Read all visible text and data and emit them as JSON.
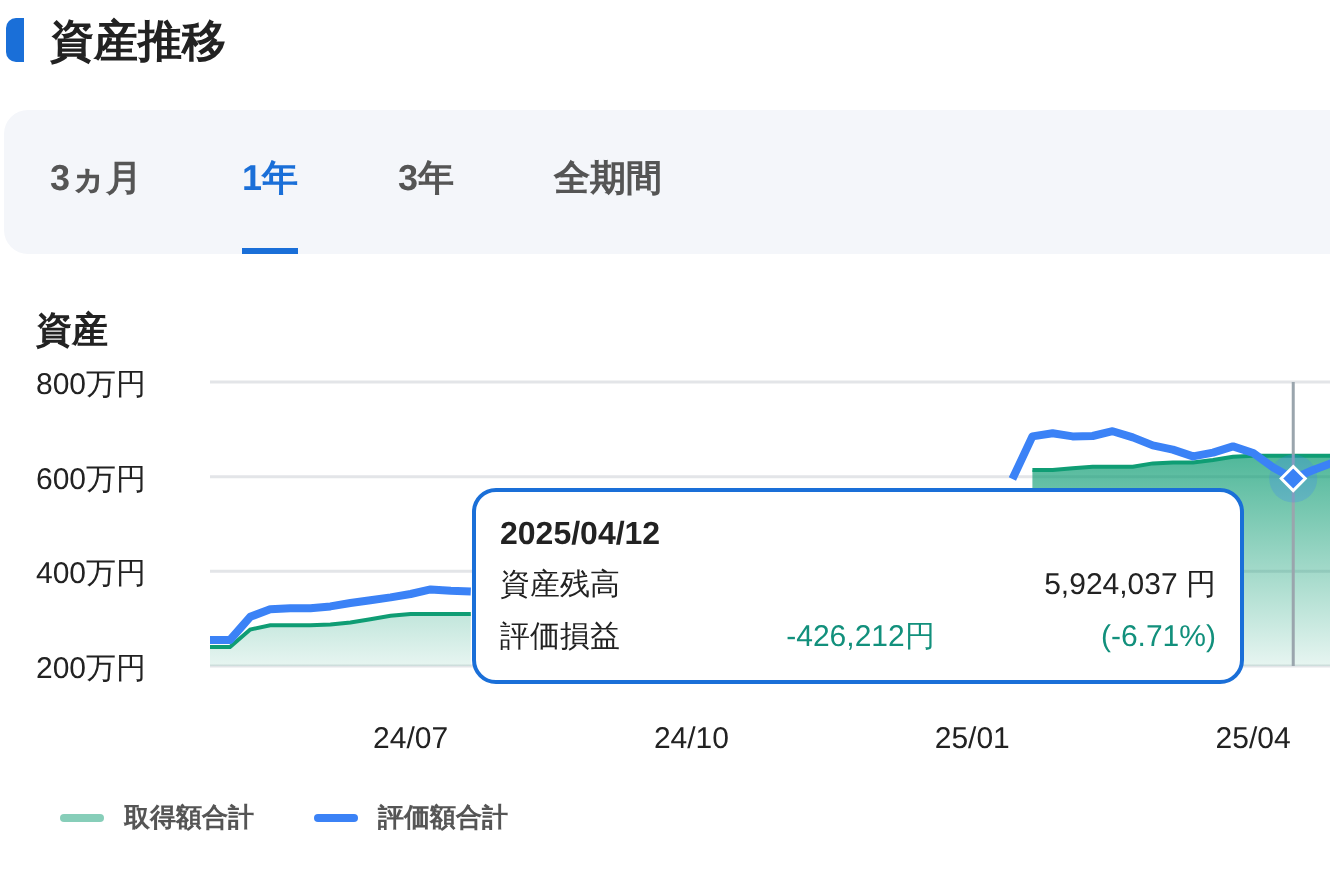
{
  "title": "資産推移",
  "tabs": [
    {
      "label": "3ヵ月",
      "selected": false
    },
    {
      "label": "1年",
      "selected": true
    },
    {
      "label": "3年",
      "selected": false
    },
    {
      "label": "全期間",
      "selected": false
    }
  ],
  "section_title": "資産",
  "chart_data": {
    "type": "line",
    "categories": [
      null,
      null,
      null,
      null,
      null,
      null,
      null,
      null,
      null,
      null,
      "24/07",
      null,
      null,
      null,
      null,
      null,
      null,
      null,
      null,
      null,
      null,
      null,
      null,
      null,
      "24/10",
      null,
      null,
      null,
      null,
      null,
      null,
      null,
      null,
      null,
      null,
      null,
      null,
      null,
      "25/01",
      null,
      null,
      null,
      null,
      null,
      null,
      null,
      null,
      null,
      null,
      null,
      null,
      null,
      "25/04",
      null,
      null,
      null,
      null
    ],
    "series": [
      {
        "name": "取得額合計",
        "color": "#0f9d74",
        "values": [
          240,
          240,
          277,
          286,
          286,
          286,
          288,
          292,
          299,
          306,
          310,
          310,
          310,
          310,
          null,
          null,
          null,
          null,
          null,
          null,
          null,
          null,
          null,
          null,
          null,
          null,
          null,
          null,
          null,
          null,
          null,
          null,
          null,
          null,
          null,
          null,
          null,
          null,
          null,
          null,
          null,
          614,
          614,
          618,
          621,
          621,
          621,
          628,
          630,
          630,
          635,
          642,
          644,
          644,
          644,
          644,
          644
        ]
      },
      {
        "name": "評価額合計",
        "color": "#3b82f6",
        "values": [
          255,
          255,
          304,
          320,
          322,
          322,
          326,
          333,
          339,
          345,
          352,
          362,
          359,
          357,
          null,
          null,
          null,
          null,
          null,
          null,
          null,
          null,
          null,
          null,
          null,
          null,
          null,
          null,
          null,
          null,
          null,
          null,
          null,
          null,
          null,
          null,
          null,
          null,
          null,
          null,
          595,
          685,
          692,
          685,
          686,
          696,
          683,
          666,
          657,
          643,
          651,
          664,
          650,
          619,
          596,
          614,
          630
        ]
      }
    ],
    "ylim": [
      200,
      800
    ],
    "yticks": [
      {
        "value": 200,
        "label": "200万円"
      },
      {
        "value": 400,
        "label": "400万円"
      },
      {
        "value": 600,
        "label": "600万円"
      },
      {
        "value": 800,
        "label": "800万円"
      }
    ]
  },
  "tooltip": {
    "date": "2025/04/12",
    "rows": [
      {
        "label": "資産残高",
        "value": "5,924,037 円",
        "kind": "plain"
      },
      {
        "label": "評価損益",
        "value": "-426,212円",
        "percent": "(-6.71%)",
        "kind": "gain"
      }
    ]
  }
}
